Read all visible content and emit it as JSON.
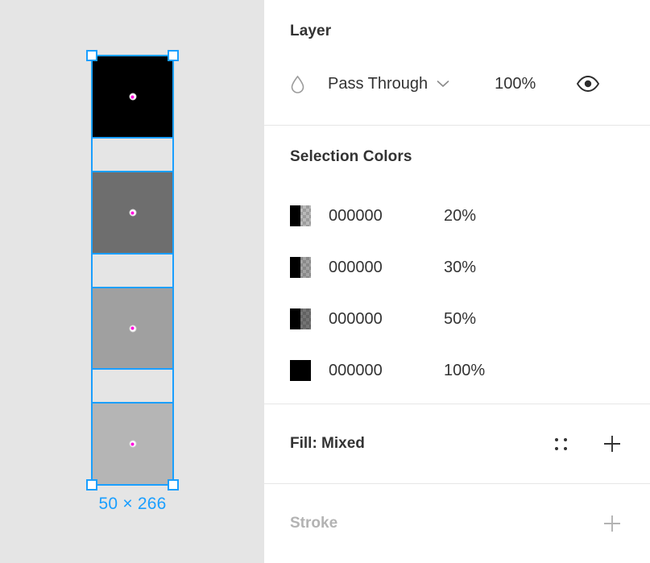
{
  "canvas": {
    "background_color": "#e5e5e5",
    "selection_color": "#1a9fff",
    "center_dot_color": "#ff00dd",
    "dimension_label": "50 × 266",
    "rects": [
      {
        "name": "rect-black",
        "fill": "#000000",
        "opacity_label": "100%"
      },
      {
        "name": "rect-gray-50",
        "fill": "#6e6e6e",
        "opacity_label": "50%"
      },
      {
        "name": "rect-gray-30",
        "fill": "#a0a0a0",
        "opacity_label": "30%"
      },
      {
        "name": "rect-gray-20",
        "fill": "#b5b5b5",
        "opacity_label": "20%"
      }
    ]
  },
  "panel": {
    "layer": {
      "title": "Layer",
      "blend_mode": "Pass Through",
      "opacity": "100%",
      "blend_icon": "droplet-icon",
      "chevron_icon": "chevron-down-icon",
      "visibility_icon": "eye-icon"
    },
    "selection_colors": {
      "title": "Selection Colors",
      "rows": [
        {
          "hex": "000000",
          "opacity": "20%",
          "alpha": 0.2
        },
        {
          "hex": "000000",
          "opacity": "30%",
          "alpha": 0.3
        },
        {
          "hex": "000000",
          "opacity": "50%",
          "alpha": 0.5
        },
        {
          "hex": "000000",
          "opacity": "100%",
          "alpha": 1.0
        }
      ]
    },
    "fill": {
      "title": "Fill: Mixed",
      "styles_icon": "four-dots-grid-icon",
      "add_icon": "plus-icon"
    },
    "stroke": {
      "title": "Stroke",
      "add_icon": "plus-icon"
    }
  }
}
